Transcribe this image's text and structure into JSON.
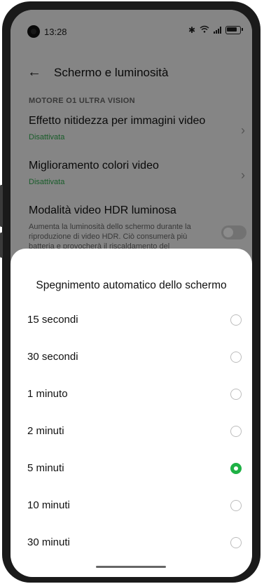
{
  "status_bar": {
    "time": "13:28"
  },
  "header": {
    "back_icon": "arrow-left-icon",
    "title": "Schermo e luminosità"
  },
  "settings": {
    "section_header": "MOTORE O1 ULTRA VISION",
    "items": [
      {
        "title": "Effetto nitidezza per immagini video",
        "subtitle": "Disattivata"
      },
      {
        "title": "Miglioramento colori video",
        "subtitle": "Disattivata"
      },
      {
        "title": "Modalità video HDR luminosa",
        "description": "Aumenta la luminosità dello schermo durante la riproduzione di video HDR. Ciò consumerà più batteria e provocherà il riscaldamento del"
      }
    ]
  },
  "sheet": {
    "title": "Spegnimento automatico dello schermo",
    "options": [
      {
        "label": "15 secondi",
        "selected": false
      },
      {
        "label": "30 secondi",
        "selected": false
      },
      {
        "label": "1 minuto",
        "selected": false
      },
      {
        "label": "2 minuti",
        "selected": false
      },
      {
        "label": "5 minuti",
        "selected": true
      },
      {
        "label": "10 minuti",
        "selected": false
      },
      {
        "label": "30 minuti",
        "selected": false
      }
    ]
  },
  "colors": {
    "accent": "#1fb145",
    "subtitle_green": "#2fa94e"
  }
}
